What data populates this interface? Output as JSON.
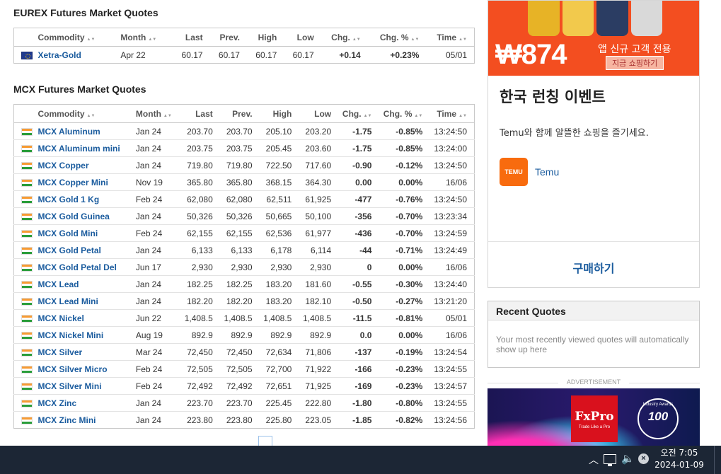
{
  "eurex": {
    "title": "EUREX Futures Market Quotes",
    "columns": [
      "Commodity",
      "Month",
      "Last",
      "Prev.",
      "High",
      "Low",
      "Chg.",
      "Chg. %",
      "Time"
    ],
    "rows": [
      {
        "flag": "eu-flag-icon",
        "name": "Xetra-Gold",
        "month": "Apr 22",
        "last": "60.17",
        "prev": "60.17",
        "high": "60.17",
        "low": "60.17",
        "chg": "+0.14",
        "chgpct": "+0.23%",
        "time": "05/01",
        "dir": "pos"
      }
    ]
  },
  "mcx": {
    "title": "MCX Futures Market Quotes",
    "columns": [
      "Commodity",
      "Month",
      "Last",
      "Prev.",
      "High",
      "Low",
      "Chg.",
      "Chg. %",
      "Time"
    ],
    "rows": [
      {
        "name": "MCX Aluminum",
        "month": "Jan 24",
        "last": "203.70",
        "prev": "203.70",
        "high": "205.10",
        "low": "203.20",
        "chg": "-1.75",
        "chgpct": "-0.85%",
        "time": "13:24:50",
        "dir": "neg"
      },
      {
        "name": "MCX Aluminum mini",
        "month": "Jan 24",
        "last": "203.75",
        "prev": "203.75",
        "high": "205.45",
        "low": "203.60",
        "chg": "-1.75",
        "chgpct": "-0.85%",
        "time": "13:24:00",
        "dir": "neg"
      },
      {
        "name": "MCX Copper",
        "month": "Jan 24",
        "last": "719.80",
        "prev": "719.80",
        "high": "722.50",
        "low": "717.60",
        "chg": "-0.90",
        "chgpct": "-0.12%",
        "time": "13:24:50",
        "dir": "neg"
      },
      {
        "name": "MCX Copper Mini",
        "month": "Nov 19",
        "last": "365.80",
        "prev": "365.80",
        "high": "368.15",
        "low": "364.30",
        "chg": "0.00",
        "chgpct": "0.00%",
        "time": "16/06",
        "dir": "neu"
      },
      {
        "name": "MCX Gold 1 Kg",
        "month": "Feb 24",
        "last": "62,080",
        "prev": "62,080",
        "high": "62,511",
        "low": "61,925",
        "chg": "-477",
        "chgpct": "-0.76%",
        "time": "13:24:50",
        "dir": "neg"
      },
      {
        "name": "MCX Gold Guinea",
        "month": "Jan 24",
        "last": "50,326",
        "prev": "50,326",
        "high": "50,665",
        "low": "50,100",
        "chg": "-356",
        "chgpct": "-0.70%",
        "time": "13:23:34",
        "dir": "neg"
      },
      {
        "name": "MCX Gold Mini",
        "month": "Feb 24",
        "last": "62,155",
        "prev": "62,155",
        "high": "62,536",
        "low": "61,977",
        "chg": "-436",
        "chgpct": "-0.70%",
        "time": "13:24:59",
        "dir": "neg"
      },
      {
        "name": "MCX Gold Petal",
        "month": "Jan 24",
        "last": "6,133",
        "prev": "6,133",
        "high": "6,178",
        "low": "6,114",
        "chg": "-44",
        "chgpct": "-0.71%",
        "time": "13:24:49",
        "dir": "neg"
      },
      {
        "name": "MCX Gold Petal Del",
        "month": "Jun 17",
        "last": "2,930",
        "prev": "2,930",
        "high": "2,930",
        "low": "2,930",
        "chg": "0",
        "chgpct": "0.00%",
        "time": "16/06",
        "dir": "neu"
      },
      {
        "name": "MCX Lead",
        "month": "Jan 24",
        "last": "182.25",
        "prev": "182.25",
        "high": "183.20",
        "low": "181.60",
        "chg": "-0.55",
        "chgpct": "-0.30%",
        "time": "13:24:40",
        "dir": "neg"
      },
      {
        "name": "MCX Lead Mini",
        "month": "Jan 24",
        "last": "182.20",
        "prev": "182.20",
        "high": "183.20",
        "low": "182.10",
        "chg": "-0.50",
        "chgpct": "-0.27%",
        "time": "13:21:20",
        "dir": "neg"
      },
      {
        "name": "MCX Nickel",
        "month": "Jun 22",
        "last": "1,408.5",
        "prev": "1,408.5",
        "high": "1,408.5",
        "low": "1,408.5",
        "chg": "-11.5",
        "chgpct": "-0.81%",
        "time": "05/01",
        "dir": "neu"
      },
      {
        "name": "MCX Nickel Mini",
        "month": "Aug 19",
        "last": "892.9",
        "prev": "892.9",
        "high": "892.9",
        "low": "892.9",
        "chg": "0.0",
        "chgpct": "0.00%",
        "time": "16/06",
        "dir": "neu"
      },
      {
        "name": "MCX Silver",
        "month": "Mar 24",
        "last": "72,450",
        "prev": "72,450",
        "high": "72,634",
        "low": "71,806",
        "chg": "-137",
        "chgpct": "-0.19%",
        "time": "13:24:54",
        "dir": "neg"
      },
      {
        "name": "MCX Silver Micro",
        "month": "Feb 24",
        "last": "72,505",
        "prev": "72,505",
        "high": "72,700",
        "low": "71,922",
        "chg": "-166",
        "chgpct": "-0.23%",
        "time": "13:24:55",
        "dir": "neg"
      },
      {
        "name": "MCX Silver Mini",
        "month": "Feb 24",
        "last": "72,492",
        "prev": "72,492",
        "high": "72,651",
        "low": "71,925",
        "chg": "-169",
        "chgpct": "-0.23%",
        "time": "13:24:57",
        "dir": "neg"
      },
      {
        "name": "MCX Zinc",
        "month": "Jan 24",
        "last": "223.70",
        "prev": "223.70",
        "high": "225.45",
        "low": "222.80",
        "chg": "-1.80",
        "chgpct": "-0.80%",
        "time": "13:24:55",
        "dir": "neg"
      },
      {
        "name": "MCX Zinc Mini",
        "month": "Jan 24",
        "last": "223.80",
        "prev": "223.80",
        "high": "225.80",
        "low": "223.05",
        "chg": "-1.85",
        "chgpct": "-0.82%",
        "time": "13:24:56",
        "dir": "neg"
      }
    ]
  },
  "ad": {
    "price": "₩874",
    "subtitle": "앱 신규 고객 전용",
    "shop_button": "지금 쇼핑하기",
    "headline": "한국 런칭 이벤트",
    "description": "Temu와 함께 알뜰한 쇼핑을 즐기세요.",
    "brand_logo_text": "TEMU",
    "brand_name": "Temu",
    "buy_label": "구매하기"
  },
  "recent_quotes": {
    "title": "Recent Quotes",
    "empty_text": "Your most recently viewed quotes will automatically show up here"
  },
  "advertisement_label": "ADVERTISEMENT",
  "fxpro_ad": {
    "brand": "FxPro",
    "tagline": "Trade Like a Pro",
    "award_number": "100",
    "award_caption": "Industry Awards"
  },
  "taskbar": {
    "time": "오전 7:05",
    "date": "2024-01-09"
  },
  "colors": {
    "link": "#1b5c9e",
    "negative": "#e21b1b",
    "positive": "#22a022",
    "ad_orange": "#f34e20",
    "taskbar": "#1c2635"
  }
}
